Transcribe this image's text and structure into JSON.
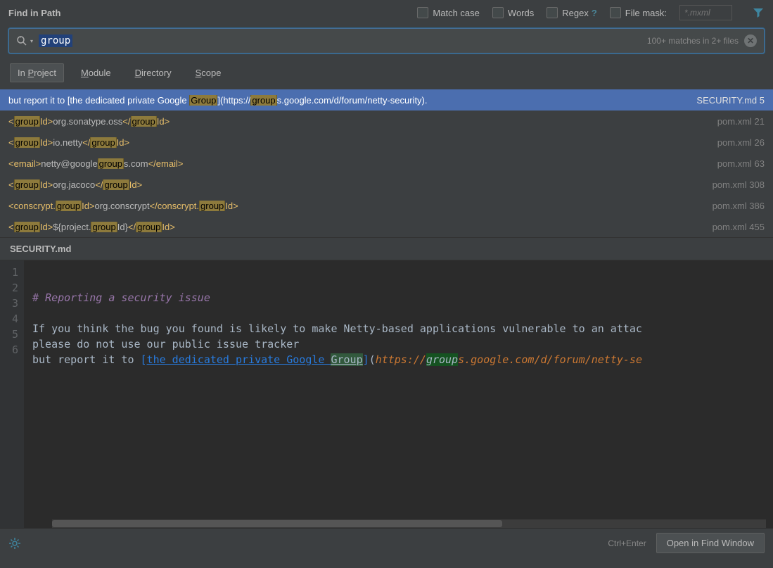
{
  "header": {
    "title": "Find in Path",
    "options": {
      "match_case": "Match case",
      "words": "Words",
      "regex": "Regex",
      "regex_help": "?",
      "file_mask": "File mask:",
      "file_mask_placeholder": "*.mxml"
    }
  },
  "search": {
    "query": "group",
    "matches_info": "100+ matches in 2+ files"
  },
  "scope": {
    "tabs": [
      {
        "id": "project",
        "label": "In Project",
        "active": true
      },
      {
        "id": "module",
        "label": "Module",
        "active": false
      },
      {
        "id": "directory",
        "label": "Directory",
        "active": false
      },
      {
        "id": "scope",
        "label": "Scope",
        "active": false
      }
    ]
  },
  "results": [
    {
      "selected": true,
      "file": "SECURITY.md",
      "line": 5,
      "segments": [
        {
          "t": "but report it to [the dedicated private Google "
        },
        {
          "t": "Group",
          "hl": true
        },
        {
          "t": "](https://"
        },
        {
          "t": "group",
          "hl": true
        },
        {
          "t": "s.google.com/d/forum/netty-security)."
        }
      ]
    },
    {
      "file": "pom.xml",
      "line": 21,
      "segments": [
        {
          "t": "<",
          "xml": true
        },
        {
          "t": "group",
          "hl": true
        },
        {
          "t": "Id>",
          "xml": true
        },
        {
          "t": "org.sonatype.oss"
        },
        {
          "t": "</",
          "xml": true
        },
        {
          "t": "group",
          "hl": true
        },
        {
          "t": "Id>",
          "xml": true
        }
      ]
    },
    {
      "file": "pom.xml",
      "line": 26,
      "segments": [
        {
          "t": "<",
          "xml": true
        },
        {
          "t": "group",
          "hl": true
        },
        {
          "t": "Id>",
          "xml": true
        },
        {
          "t": "io.netty"
        },
        {
          "t": "</",
          "xml": true
        },
        {
          "t": "group",
          "hl": true
        },
        {
          "t": "Id>",
          "xml": true
        }
      ]
    },
    {
      "file": "pom.xml",
      "line": 63,
      "segments": [
        {
          "t": "<email>",
          "xml": true
        },
        {
          "t": "netty@google"
        },
        {
          "t": "group",
          "hl": true
        },
        {
          "t": "s.com"
        },
        {
          "t": "</email>",
          "xml": true
        }
      ]
    },
    {
      "file": "pom.xml",
      "line": 308,
      "segments": [
        {
          "t": "<",
          "xml": true
        },
        {
          "t": "group",
          "hl": true
        },
        {
          "t": "Id>",
          "xml": true
        },
        {
          "t": "org.jacoco"
        },
        {
          "t": "</",
          "xml": true
        },
        {
          "t": "group",
          "hl": true
        },
        {
          "t": "Id>",
          "xml": true
        }
      ]
    },
    {
      "file": "pom.xml",
      "line": 386,
      "segments": [
        {
          "t": "<conscrypt.",
          "xml": true
        },
        {
          "t": "group",
          "hl": true
        },
        {
          "t": "Id>",
          "xml": true
        },
        {
          "t": "org.conscrypt"
        },
        {
          "t": "</conscrypt.",
          "xml": true
        },
        {
          "t": "group",
          "hl": true
        },
        {
          "t": "Id>",
          "xml": true
        }
      ]
    },
    {
      "file": "pom.xml",
      "line": 455,
      "segments": [
        {
          "t": "<",
          "xml": true
        },
        {
          "t": "group",
          "hl": true
        },
        {
          "t": "Id>",
          "xml": true
        },
        {
          "t": "${project."
        },
        {
          "t": "group",
          "hl": true
        },
        {
          "t": "Id}"
        },
        {
          "t": "</",
          "xml": true
        },
        {
          "t": "group",
          "hl": true
        },
        {
          "t": "Id>",
          "xml": true
        }
      ]
    }
  ],
  "preview": {
    "filename": "SECURITY.md",
    "lines": [
      {
        "n": 1,
        "parts": [
          {
            "t": "# ",
            "c": "md-h"
          },
          {
            "t": "Reporting a security issue",
            "c": "md-h md-ital"
          }
        ]
      },
      {
        "n": 2,
        "parts": []
      },
      {
        "n": 3,
        "parts": [
          {
            "t": "If you think the bug you found is likely to make Netty-based applications vulnerable to an attac",
            "c": "md-text"
          }
        ]
      },
      {
        "n": 4,
        "parts": [
          {
            "t": "please do not use our public issue tracker",
            "c": "md-text"
          }
        ]
      },
      {
        "n": 5,
        "parts": [
          {
            "t": "but report it to ",
            "c": "md-text"
          },
          {
            "t": "[",
            "c": "md-link"
          },
          {
            "t": "the dedicated private Google ",
            "c": "md-link md-link-u"
          },
          {
            "t": "Group",
            "c": "md-link md-link-u prev-hl"
          },
          {
            "t": "]",
            "c": "md-link"
          },
          {
            "t": "(",
            "c": "md-text"
          },
          {
            "t": "https://",
            "c": "md-url-o"
          },
          {
            "t": "group",
            "c": "md-url-o prev-hl2"
          },
          {
            "t": "s.google.com/d/forum/netty-se",
            "c": "md-url-o"
          }
        ]
      },
      {
        "n": 6,
        "parts": []
      }
    ]
  },
  "footer": {
    "tip": "Ctrl+Enter",
    "open": "Open in Find Window"
  }
}
